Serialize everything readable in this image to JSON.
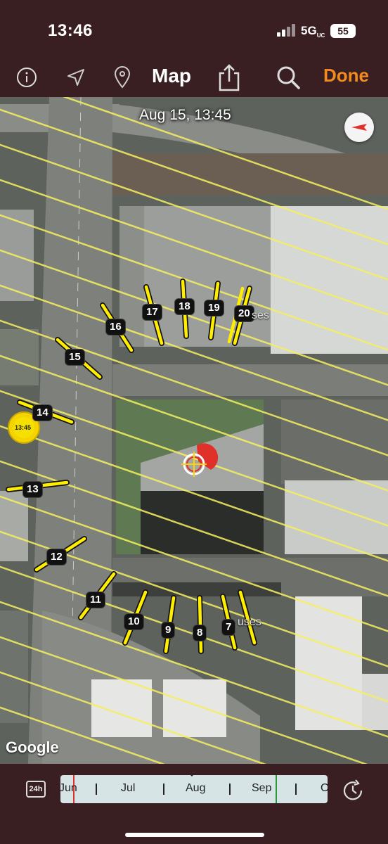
{
  "status": {
    "time": "13:46",
    "network": "5G",
    "network_suffix": "UC",
    "battery": "55"
  },
  "toolbar": {
    "title": "Map",
    "done_label": "Done",
    "icons": [
      "info-icon",
      "location-arrow-icon",
      "pin-icon",
      "share-icon",
      "search-icon"
    ]
  },
  "map": {
    "date_label": "Aug 15, 13:45",
    "sun_time": "13:45",
    "google_label": "Google",
    "place_text_1": "ses",
    "place_text_2": "uses",
    "shadow_labels": [
      "7",
      "8",
      "9",
      "10",
      "11",
      "12",
      "13",
      "14",
      "15",
      "16",
      "17",
      "18",
      "19",
      "20"
    ]
  },
  "timeline": {
    "mode_label": "24h",
    "months": [
      "Jun",
      "Jul",
      "Aug",
      "Sep",
      "O"
    ],
    "selected_month": "Aug"
  },
  "colors": {
    "background": "#3a1f22",
    "accent": "#f28a1e",
    "shadow_arrow": "#ffee00",
    "sun_line": "#f5f060"
  }
}
